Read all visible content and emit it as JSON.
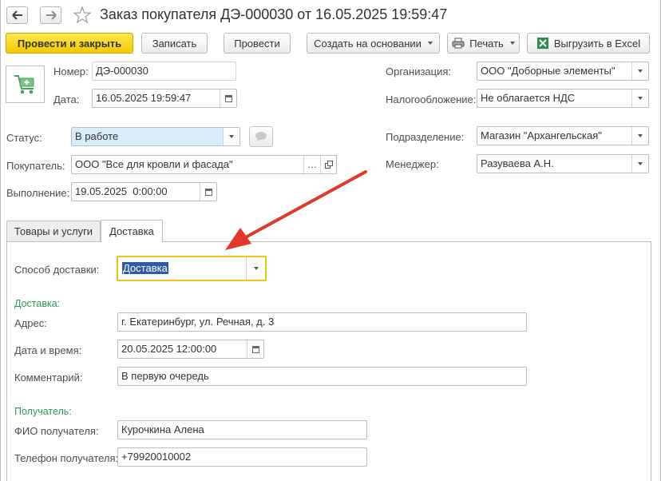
{
  "window": {
    "title": "Заказ покупателя ДЭ-000030 от 16.05.2025 19:59:47"
  },
  "toolbar": {
    "post_close": "Провести и закрыть",
    "save": "Записать",
    "post": "Провести",
    "create_based": "Создать на основании",
    "print": "Печать",
    "export_excel": "Выгрузить в Excel"
  },
  "header": {
    "number_label": "Номер:",
    "number_value": "ДЭ-000030",
    "date_label": "Дата:",
    "date_value": "16.05.2025 19:59:47",
    "org_label": "Организация:",
    "org_value": "ООО \"Доборные элементы\"",
    "tax_label": "Налогообложение:",
    "tax_value": "Не облагается НДС",
    "status_label": "Статус:",
    "status_value": "В работе",
    "buyer_label": "Покупатель:",
    "buyer_value": "ООО \"Все для кровли и фасада\"",
    "exec_label": "Выполнение:",
    "exec_value": "19.05.2025  0:00:00",
    "division_label": "Подразделение:",
    "division_value": "Магазин \"Архангельская\"",
    "manager_label": "Менеджер:",
    "manager_value": "Разуваева А.Н."
  },
  "tabs": [
    {
      "label": "Товары и услуги"
    },
    {
      "label": "Доставка"
    }
  ],
  "delivery": {
    "method_label": "Способ доставки:",
    "method_value": "Доставка",
    "section_title": "Доставка:",
    "address_label": "Адрес:",
    "address_value": "г. Екатеринбург, ул. Речная, д. 3",
    "datetime_label": "Дата и время:",
    "datetime_value": "20.05.2025 12:00:00",
    "comment_label": "Комментарий:",
    "comment_value": "В первую очередь",
    "recipient_title": "Получатель:",
    "recipient_name_label": "ФИО получателя:",
    "recipient_name_value": "Курочкина Алена",
    "recipient_phone_label": "Телефон получателя:",
    "recipient_phone_value": "+79920010002"
  },
  "colors": {
    "primary_button": "#f5c900",
    "section_title": "#2b9a5b",
    "annotation_arrow": "#e0382b",
    "focus_border": "#f0c21a"
  }
}
